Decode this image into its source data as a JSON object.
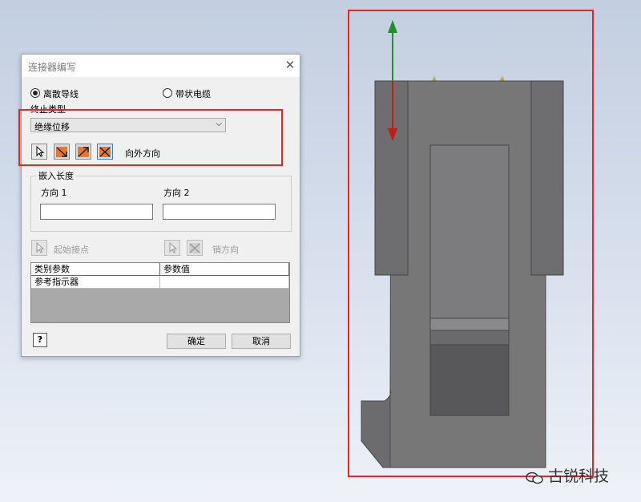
{
  "dialog": {
    "title": "连接器编写",
    "close_symbol": "✕",
    "radio_discrete": "离散导线",
    "radio_ribbon": "带状电缆",
    "selected_radio": "离散导线",
    "termination_label": "终止类型",
    "termination_value": "绝缘位移",
    "direction_label": "向外方向",
    "embed_group_label": "嵌入长度",
    "direction1_label": "方向 1",
    "direction2_label": "方向 2",
    "direction1_value": "",
    "direction2_value": "",
    "start_pin_label": "起始接点",
    "reverse_label": "销方向",
    "table_headers": [
      "类别参数",
      "参数值"
    ],
    "table_rows": [
      [
        "参考指示器",
        ""
      ]
    ],
    "help_symbol": "?",
    "ok_label": "确定",
    "cancel_label": "取消"
  },
  "viewport": {
    "axis_up_color": "#1f8f2a",
    "axis_down_color": "#c41a1a",
    "highlight_color": "#e8251f"
  },
  "watermark": "古锐科技"
}
